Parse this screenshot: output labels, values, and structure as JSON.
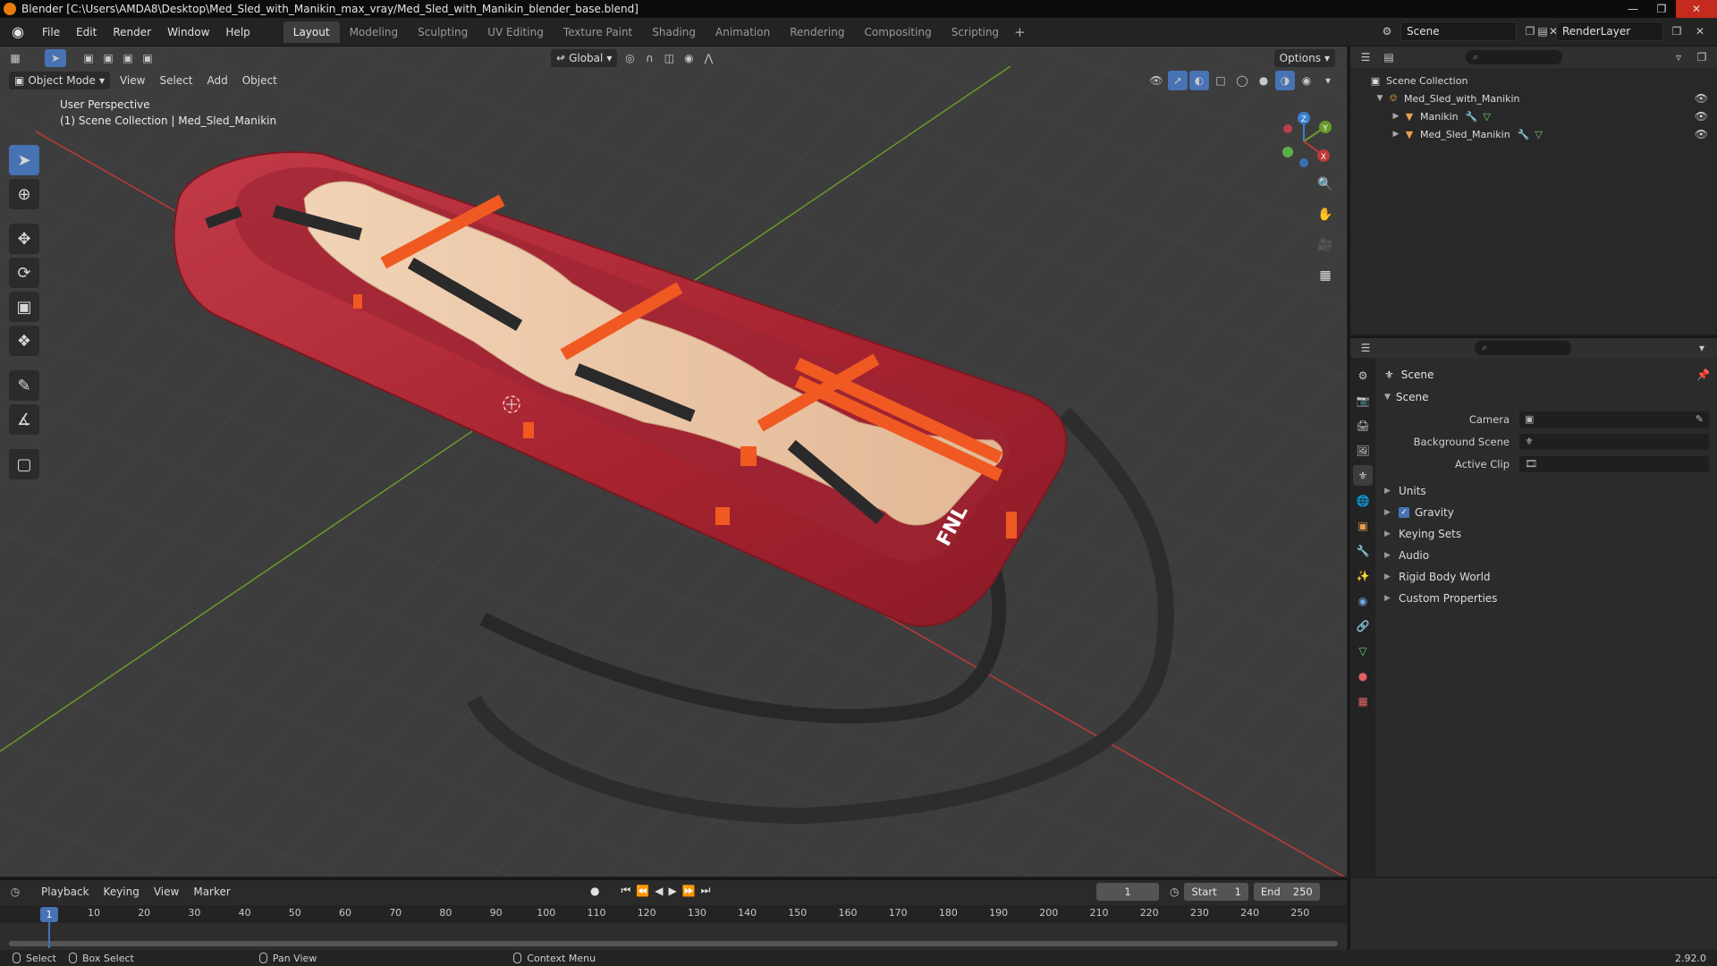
{
  "window": {
    "title": "Blender [C:\\Users\\AMDA8\\Desktop\\Med_Sled_with_Manikin_max_vray/Med_Sled_with_Manikin_blender_base.blend]"
  },
  "menu": [
    "File",
    "Edit",
    "Render",
    "Window",
    "Help"
  ],
  "workspaces": [
    "Layout",
    "Modeling",
    "Sculpting",
    "UV Editing",
    "Texture Paint",
    "Shading",
    "Animation",
    "Rendering",
    "Compositing",
    "Scripting"
  ],
  "active_workspace": "Layout",
  "scene_selector": {
    "value": "Scene"
  },
  "renderlayer_selector": {
    "value": "RenderLayer"
  },
  "viewport": {
    "mode": "Object Mode",
    "menus": [
      "View",
      "Select",
      "Add",
      "Object"
    ],
    "transform_orientation": "Global",
    "options_label": "Options",
    "info_line1": "User Perspective",
    "info_line2": "(1) Scene Collection | Med_Sled_Manikin",
    "sled_text": "FNL",
    "axis_labels": {
      "x": "X",
      "y": "Y",
      "z": "Z"
    }
  },
  "colors": {
    "sled_red": "#b02a3a",
    "strap_orange": "#f05a22",
    "strap_dark": "#2a2a2a",
    "x_axis": "#c0393b",
    "y_axis": "#6a9a2a",
    "accent": "#4772b3"
  },
  "outliner": {
    "root": "Scene Collection",
    "items": [
      {
        "name": "Med_Sled_with_Manikin",
        "depth": 1,
        "icon": "empty-icon"
      },
      {
        "name": "Manikin",
        "depth": 2,
        "icon": "mesh-object-icon"
      },
      {
        "name": "Med_Sled_Manikin",
        "depth": 2,
        "icon": "mesh-object-icon"
      }
    ]
  },
  "properties": {
    "context_title": "Scene",
    "panel_title": "Scene",
    "fields": [
      {
        "label": "Camera",
        "value": ""
      },
      {
        "label": "Background Scene",
        "value": ""
      },
      {
        "label": "Active Clip",
        "value": ""
      }
    ],
    "subpanels": [
      {
        "label": "Units",
        "checkbox": false
      },
      {
        "label": "Gravity",
        "checkbox": true
      },
      {
        "label": "Keying Sets",
        "checkbox": false
      },
      {
        "label": "Audio",
        "checkbox": false
      },
      {
        "label": "Rigid Body World",
        "checkbox": false
      },
      {
        "label": "Custom Properties",
        "checkbox": false
      }
    ]
  },
  "timeline": {
    "menus": [
      "Playback",
      "Keying",
      "View",
      "Marker"
    ],
    "current_frame": "1",
    "start_label": "Start",
    "start": "1",
    "end_label": "End",
    "end": "250",
    "ticks": [
      "10",
      "20",
      "30",
      "40",
      "50",
      "60",
      "70",
      "80",
      "90",
      "100",
      "110",
      "120",
      "130",
      "140",
      "150",
      "160",
      "170",
      "180",
      "190",
      "200",
      "210",
      "220",
      "230",
      "240",
      "250"
    ],
    "playhead_label": "1"
  },
  "statusbar": {
    "select": "Select",
    "box_select": "Box Select",
    "pan_view": "Pan View",
    "context_menu": "Context Menu",
    "version": "2.92.0"
  }
}
